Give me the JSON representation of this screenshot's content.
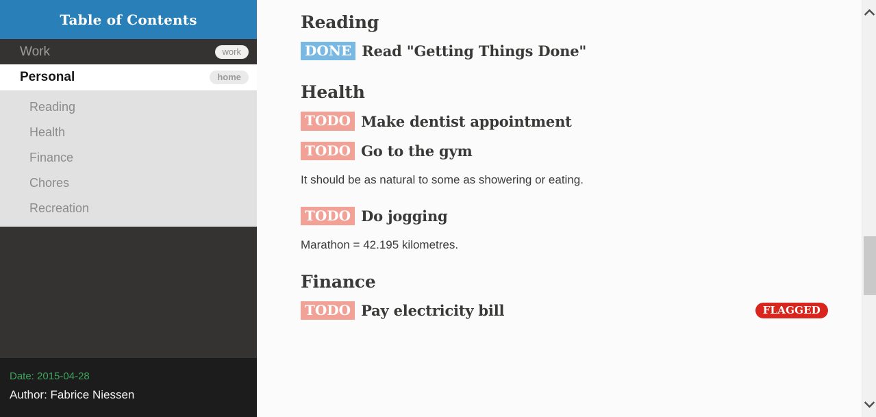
{
  "sidebar": {
    "header_title": "Table of Contents",
    "nav_top": {
      "label": "Work",
      "tag": "work"
    },
    "nav_current": {
      "label": "Personal",
      "tag": "home"
    },
    "sub_items": [
      {
        "label": "Reading"
      },
      {
        "label": "Health"
      },
      {
        "label": "Finance"
      },
      {
        "label": "Chores"
      },
      {
        "label": "Recreation"
      }
    ],
    "footer": {
      "date": "Date: 2015-04-28",
      "author": "Author: Fabrice Niessen"
    }
  },
  "document": {
    "sections": [
      {
        "heading": "Reading",
        "tasks": [
          {
            "keyword": "DONE",
            "title": "Read \"Getting Things Done\"",
            "flag": ""
          }
        ],
        "paragraphs": []
      },
      {
        "heading": "Health",
        "tasks": [
          {
            "keyword": "TODO",
            "title": "Make dentist appointment",
            "flag": ""
          },
          {
            "keyword": "TODO",
            "title": "Go to the gym",
            "flag": ""
          }
        ],
        "paragraphs": [
          "It should be as natural to some as showering or eating."
        ]
      },
      {
        "heading": "Finance",
        "tasks": [
          {
            "keyword": "TODO",
            "title": "Pay electricity bill",
            "flag": "FLAGGED"
          }
        ],
        "paragraphs": []
      }
    ],
    "jogging_task": {
      "keyword": "TODO",
      "title": "Do jogging"
    },
    "jogging_note": "Marathon = 42.195 kilometres.",
    "health_note": "It should be as natural to some as showering or eating."
  },
  "colors": {
    "header_blue": "#2980b9",
    "sidebar_dark": "#343331",
    "sidebar_footer": "#1c1c1c",
    "todo_badge": "#f2a196",
    "done_badge": "#79b8e3",
    "flag_red": "#d8261e",
    "date_green": "#3fa35f"
  },
  "scrollbar": {
    "up_arrow": "chevron-up-icon",
    "down_arrow": "chevron-down-icon"
  }
}
